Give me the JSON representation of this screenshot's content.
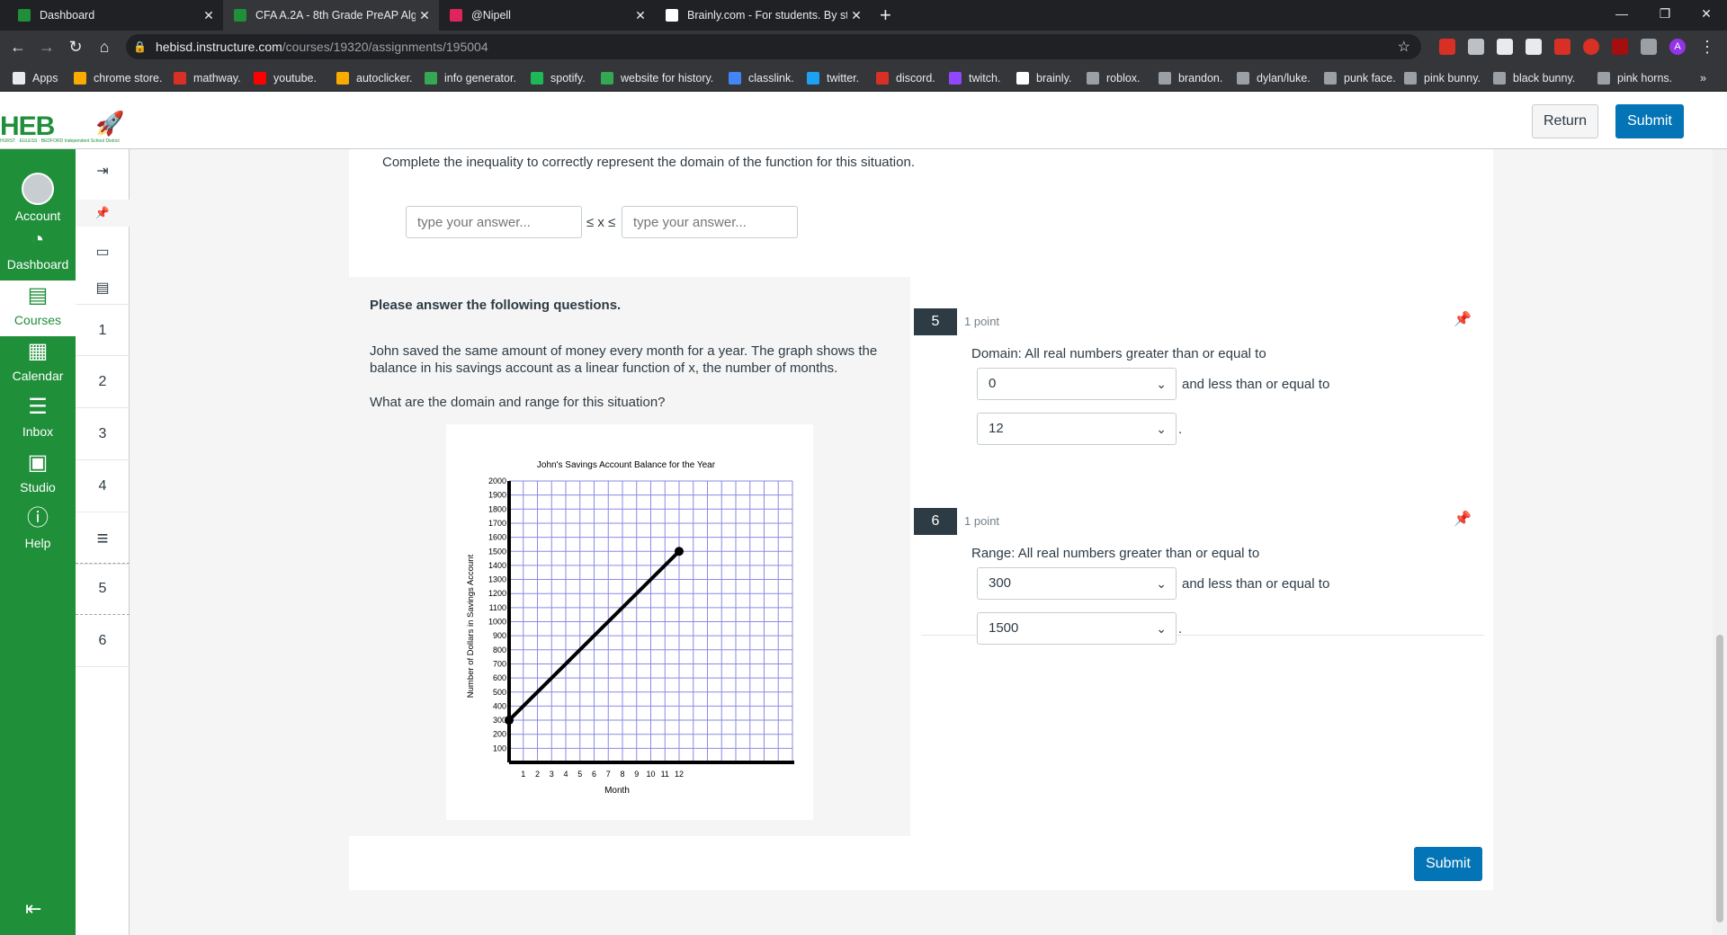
{
  "browser": {
    "tabs": [
      {
        "title": "Dashboard",
        "favicon_color": "#1f8f3a"
      },
      {
        "title": "CFA A.2A - 8th Grade PreAP Alge",
        "favicon_color": "#1f8f3a"
      },
      {
        "title": "@Nipell",
        "favicon_color": "#e0245e"
      },
      {
        "title": "Brainly.com - For students. By stu",
        "favicon_color": "#ffffff"
      }
    ],
    "url_host": "hebisd.instructure.com",
    "url_path": "/courses/19320/assignments/195004",
    "profile_initial": "A"
  },
  "bookmarks": [
    {
      "label": "Apps",
      "color": "#e8eaed"
    },
    {
      "label": "chrome store.",
      "color": "#f9ab00"
    },
    {
      "label": "mathway.",
      "color": "#d93025"
    },
    {
      "label": "youtube.",
      "color": "#ff0000"
    },
    {
      "label": "autoclicker.",
      "color": "#f9ab00"
    },
    {
      "label": "info generator.",
      "color": "#34a853"
    },
    {
      "label": "spotify.",
      "color": "#1db954"
    },
    {
      "label": "website for history.",
      "color": "#34a853"
    },
    {
      "label": "classlink.",
      "color": "#4285f4"
    },
    {
      "label": "twitter.",
      "color": "#1da1f2"
    },
    {
      "label": "discord.",
      "color": "#d93025"
    },
    {
      "label": "twitch.",
      "color": "#9146ff"
    },
    {
      "label": "brainly.",
      "color": "#ffffff"
    },
    {
      "label": "roblox.",
      "color": "#9aa0a6"
    },
    {
      "label": "brandon.",
      "color": "#9aa0a6"
    },
    {
      "label": "dylan/luke.",
      "color": "#9aa0a6"
    },
    {
      "label": "punk face.",
      "color": "#9aa0a6"
    },
    {
      "label": "pink bunny.",
      "color": "#9aa0a6"
    },
    {
      "label": "black bunny.",
      "color": "#9aa0a6"
    },
    {
      "label": "pink horns.",
      "color": "#9aa0a6"
    }
  ],
  "header": {
    "logo": "HEB",
    "logo_sub": "HURST · EULESS · BEDFORD  Independent School District",
    "return_label": "Return",
    "submit_label": "Submit"
  },
  "global_nav": [
    {
      "label": "Account",
      "icon": "account-icon"
    },
    {
      "label": "Dashboard",
      "icon": "dashboard-icon"
    },
    {
      "label": "Courses",
      "icon": "courses-icon"
    },
    {
      "label": "Calendar",
      "icon": "calendar-icon"
    },
    {
      "label": "Inbox",
      "icon": "inbox-icon"
    },
    {
      "label": "Studio",
      "icon": "studio-icon"
    },
    {
      "label": "Help",
      "icon": "help-icon"
    }
  ],
  "question_nav": [
    "1",
    "2",
    "3",
    "4",
    "5",
    "6"
  ],
  "prev_question": {
    "text": "Complete the inequality to correctly represent the domain of the function for this situation.",
    "placeholder": "type your answer...",
    "inequality": "≤ x ≤"
  },
  "stimulus": {
    "heading": "Please answer the following questions.",
    "para1": "John saved the same amount of money every month for a year. The graph shows the balance in his savings account as a linear function of x, the number of months.",
    "para2": "What are the domain and range for this situation?"
  },
  "chart_data": {
    "type": "line",
    "title": "John's Savings Account Balance for the Year",
    "xlabel": "Month",
    "ylabel": "Number of Dollars in Savings Account",
    "x_ticks": [
      1,
      2,
      3,
      4,
      5,
      6,
      7,
      8,
      9,
      10,
      11,
      12
    ],
    "y_ticks": [
      100,
      200,
      300,
      400,
      500,
      600,
      700,
      800,
      900,
      1000,
      1100,
      1200,
      1300,
      1400,
      1500,
      1600,
      1700,
      1800,
      1900,
      2000
    ],
    "xlim": [
      0,
      20
    ],
    "ylim": [
      0,
      2000
    ],
    "grid": true,
    "series": [
      {
        "x": [
          0,
          12
        ],
        "y": [
          300,
          1500
        ]
      }
    ]
  },
  "questions": [
    {
      "number": "5",
      "points": "1 point",
      "prompt": "Domain: All real numbers greater than or equal to",
      "select1": "0",
      "middle": "and less than or equal to",
      "select2": "12",
      "end": "."
    },
    {
      "number": "6",
      "points": "1 point",
      "prompt": "Range: All real numbers greater than or equal to",
      "select1": "300",
      "middle": "and less than or equal to",
      "select2": "1500",
      "end": "."
    }
  ],
  "footer": {
    "submit_label": "Submit"
  }
}
